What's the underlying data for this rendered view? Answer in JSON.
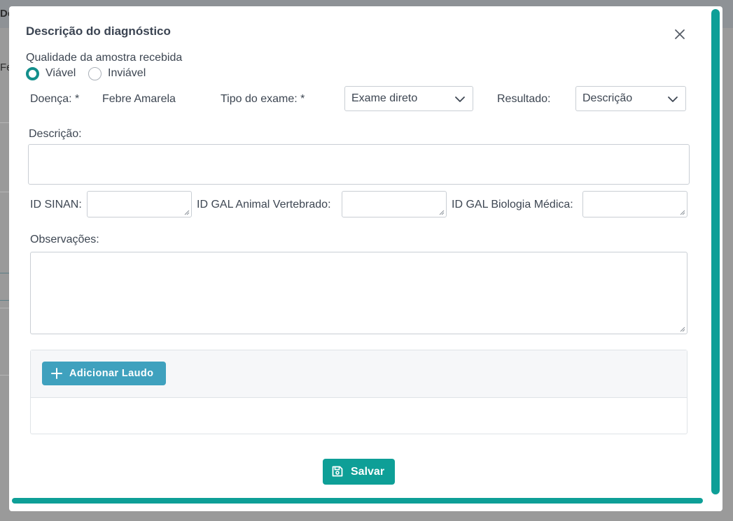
{
  "background": {
    "partial_title": "Do",
    "partial_label": "Fe"
  },
  "modal": {
    "title": "Descrição do diagnóstico",
    "sample_quality": {
      "label": "Qualidade da amostra recebida",
      "options": [
        "Viável",
        "Inviável"
      ],
      "selected": "Viável"
    },
    "disease": {
      "label": "Doença: *",
      "value": "Febre Amarela"
    },
    "exam_type": {
      "label": "Tipo do exame: *",
      "value": "Exame direto"
    },
    "result": {
      "label": "Resultado:",
      "value": "Descrição"
    },
    "description": {
      "label": "Descrição:",
      "value": ""
    },
    "id_sinan": {
      "label": "ID SINAN:",
      "value": ""
    },
    "id_gal_animal": {
      "label": "ID GAL Animal Vertebrado:",
      "value": ""
    },
    "id_gal_bio": {
      "label": "ID GAL Biologia Médica:",
      "value": ""
    },
    "observations": {
      "label": "Observações:",
      "value": ""
    },
    "add_report_label": "Adicionar Laudo",
    "save_label": "Salvar"
  },
  "colors": {
    "accent": "#0e9f97",
    "add_button": "#3fa1be",
    "text": "#3d4652"
  },
  "icons": [
    "close-icon",
    "chevron-down-icon",
    "plus-icon",
    "save-disk-icon"
  ]
}
